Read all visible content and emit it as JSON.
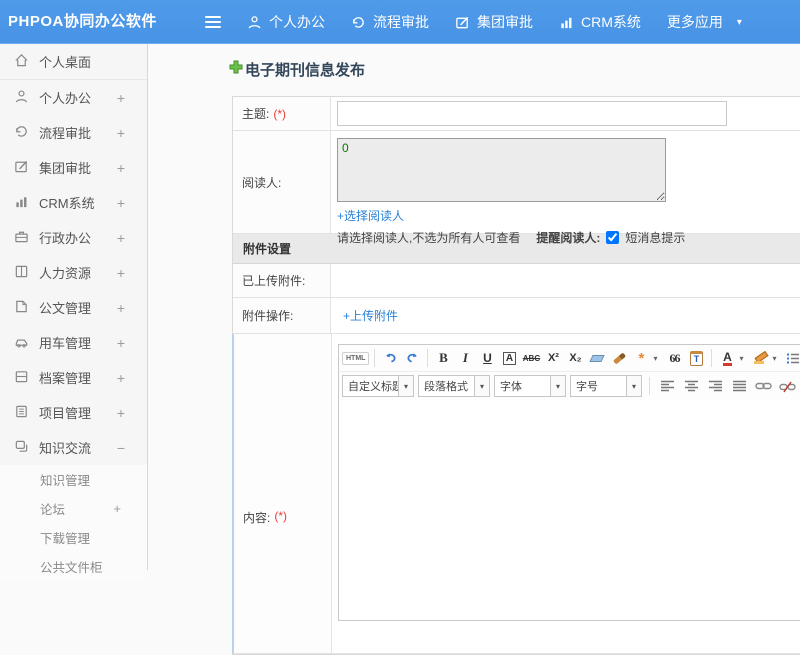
{
  "header": {
    "logo": "PHPOA协同办公软件",
    "nav": [
      {
        "icon": "user-icon",
        "label": "个人办公"
      },
      {
        "icon": "history-icon",
        "label": "流程审批"
      },
      {
        "icon": "edit-icon",
        "label": "集团审批"
      },
      {
        "icon": "chart-icon",
        "label": "CRM系统"
      }
    ],
    "more_label": "更多应用",
    "caret": "▾"
  },
  "sidebar": {
    "items": [
      {
        "icon": "home-icon",
        "label": "个人桌面",
        "expand": ""
      },
      {
        "icon": "user-icon",
        "label": "个人办公",
        "expand": "+"
      },
      {
        "icon": "history-icon",
        "label": "流程审批",
        "expand": "+"
      },
      {
        "icon": "edit-icon",
        "label": "集团审批",
        "expand": "+"
      },
      {
        "icon": "chart-icon",
        "label": "CRM系统",
        "expand": "+"
      },
      {
        "icon": "briefcase-icon",
        "label": "行政办公",
        "expand": "+"
      },
      {
        "icon": "book-icon",
        "label": "人力资源",
        "expand": "+"
      },
      {
        "icon": "doc-icon",
        "label": "公文管理",
        "expand": "+"
      },
      {
        "icon": "car-icon",
        "label": "用车管理",
        "expand": "+"
      },
      {
        "icon": "archive-icon",
        "label": "档案管理",
        "expand": "+"
      },
      {
        "icon": "project-icon",
        "label": "项目管理",
        "expand": "+"
      },
      {
        "icon": "layers-icon",
        "label": "知识交流",
        "expand": "−"
      }
    ],
    "subitems": [
      {
        "label": "知识管理",
        "expand": ""
      },
      {
        "label": "论坛",
        "expand": "+"
      },
      {
        "label": "下载管理",
        "expand": ""
      },
      {
        "label": "公共文件柜",
        "expand": ""
      }
    ]
  },
  "main": {
    "title": "电子期刊信息发布",
    "form": {
      "subject_label": "主题:",
      "required_mark": "(*)",
      "readers_label": "阅读人:",
      "readers_value": "0",
      "choose_readers_link": "+选择阅读人",
      "readers_note": "请选择阅读人,不选为所有人可查看",
      "remind_label": "提醒阅读人:",
      "sms_label": "短消息提示",
      "attach_section_title": "附件设置",
      "uploaded_label": "已上传附件:",
      "attach_op_label": "附件操作:",
      "upload_link": "+上传附件",
      "content_label": "内容:"
    }
  },
  "editor": {
    "glyphs": {
      "source": "HTML",
      "bold": "B",
      "italic": "I",
      "underline": "U",
      "fontborder": "A",
      "strike": "ABC",
      "sup": "X²",
      "sub": "X₂",
      "wand": "*",
      "quote": "66",
      "paste": "T",
      "forecolor": "A",
      "caret": "▾"
    },
    "dropdowns": [
      {
        "label": "自定义标题"
      },
      {
        "label": "段落格式"
      },
      {
        "label": "字体"
      },
      {
        "label": "字号"
      }
    ]
  }
}
